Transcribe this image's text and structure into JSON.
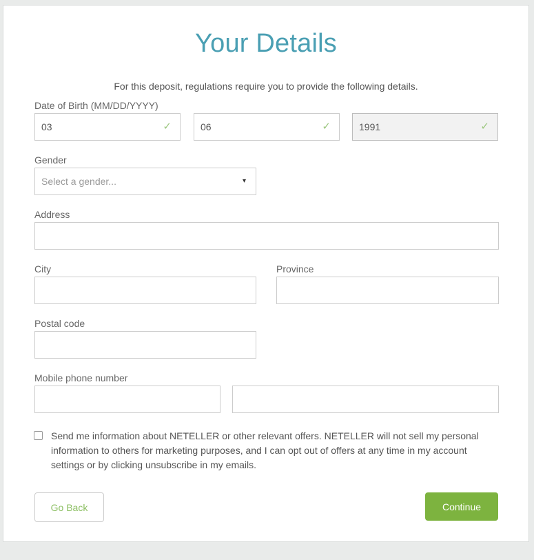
{
  "form": {
    "title": "Your Details",
    "intro": "For this deposit, regulations require you to provide the following details.",
    "dob": {
      "label": "Date of Birth (MM/DD/YYYY)",
      "month": "03",
      "day": "06",
      "year": "1991",
      "check_icon": "checkmark-icon"
    },
    "gender": {
      "label": "Gender",
      "placeholder": "Select a gender...",
      "arrow_icon": "dropdown-arrow-icon"
    },
    "address": {
      "label": "Address",
      "value": ""
    },
    "city": {
      "label": "City",
      "value": ""
    },
    "province": {
      "label": "Province",
      "value": ""
    },
    "postal_code": {
      "label": "Postal code",
      "value": ""
    },
    "mobile": {
      "label": "Mobile phone number",
      "country_code": "",
      "number": ""
    },
    "consent_text": "Send me information about NETELLER or other relevant offers. NETELLER will not sell my personal information to others for marketing purposes, and I can opt out of offers at any time in my account settings or by clicking unsubscribe in my emails.",
    "back_label": "Go Back",
    "continue_label": "Continue"
  },
  "colors": {
    "title": "#4a9fb3",
    "valid_check": "#9cc77f",
    "continue_bg": "#7db33f",
    "back_text": "#8cbf63"
  }
}
